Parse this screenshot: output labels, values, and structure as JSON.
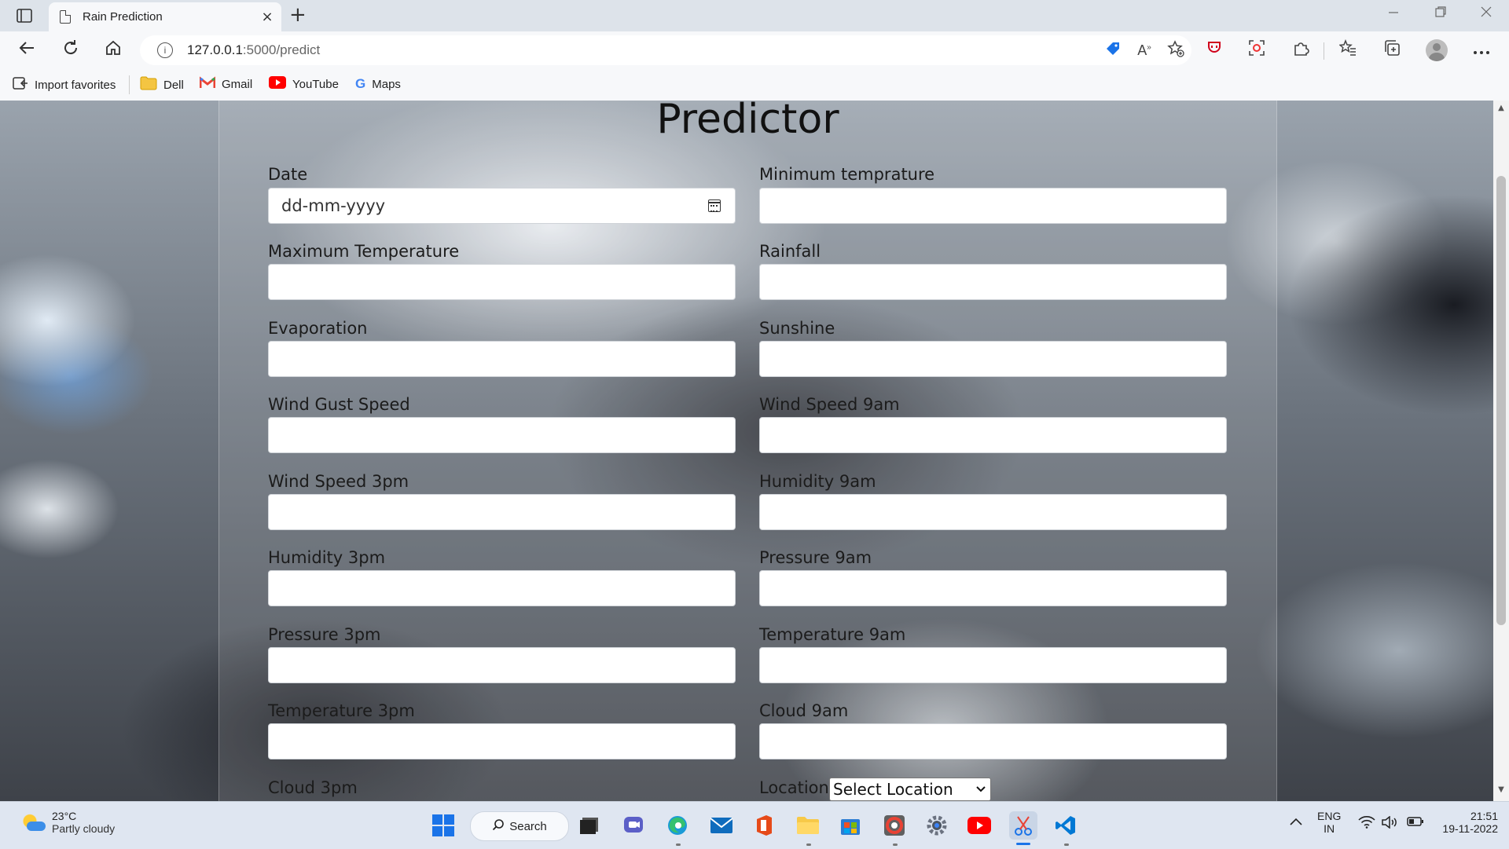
{
  "browser": {
    "tab_title": "Rain Prediction",
    "url_host": "127.0.0.1",
    "url_rest": ":5000/predict",
    "new_tab": "+",
    "close_tab": "×"
  },
  "favorites": [
    {
      "label": "Import favorites",
      "icon": "import-icon"
    },
    {
      "label": "Dell",
      "icon": "folder-icon"
    },
    {
      "label": "Gmail",
      "icon": "gmail-icon"
    },
    {
      "label": "YouTube",
      "icon": "youtube-icon"
    },
    {
      "label": "Maps",
      "icon": "google-icon"
    }
  ],
  "page": {
    "title": "Predictor",
    "date_placeholder": "dd-mm-yyyy",
    "fields_left": [
      "Date",
      "Maximum Temperature",
      "Evaporation",
      "Wind Gust Speed",
      "Wind Speed 3pm",
      "Humidity 3pm",
      "Pressure 3pm",
      "Temperature 3pm",
      "Cloud 3pm"
    ],
    "fields_right": [
      "Minimum temprature",
      "Rainfall",
      "Sunshine",
      "Wind Speed 9am",
      "Humidity 9am",
      "Pressure 9am",
      "Temperature 9am",
      "Cloud 9am",
      "Location"
    ],
    "location_selected": "Select Location"
  },
  "taskbar": {
    "weather_temp": "23°C",
    "weather_desc": "Partly cloudy",
    "search_label": "Search",
    "lang_1": "ENG",
    "lang_2": "IN",
    "time": "21:51",
    "date": "19-11-2022"
  },
  "colors": {
    "accent": "#1a73e8",
    "youtube_red": "#ff0000",
    "page_heading": "#111111"
  }
}
